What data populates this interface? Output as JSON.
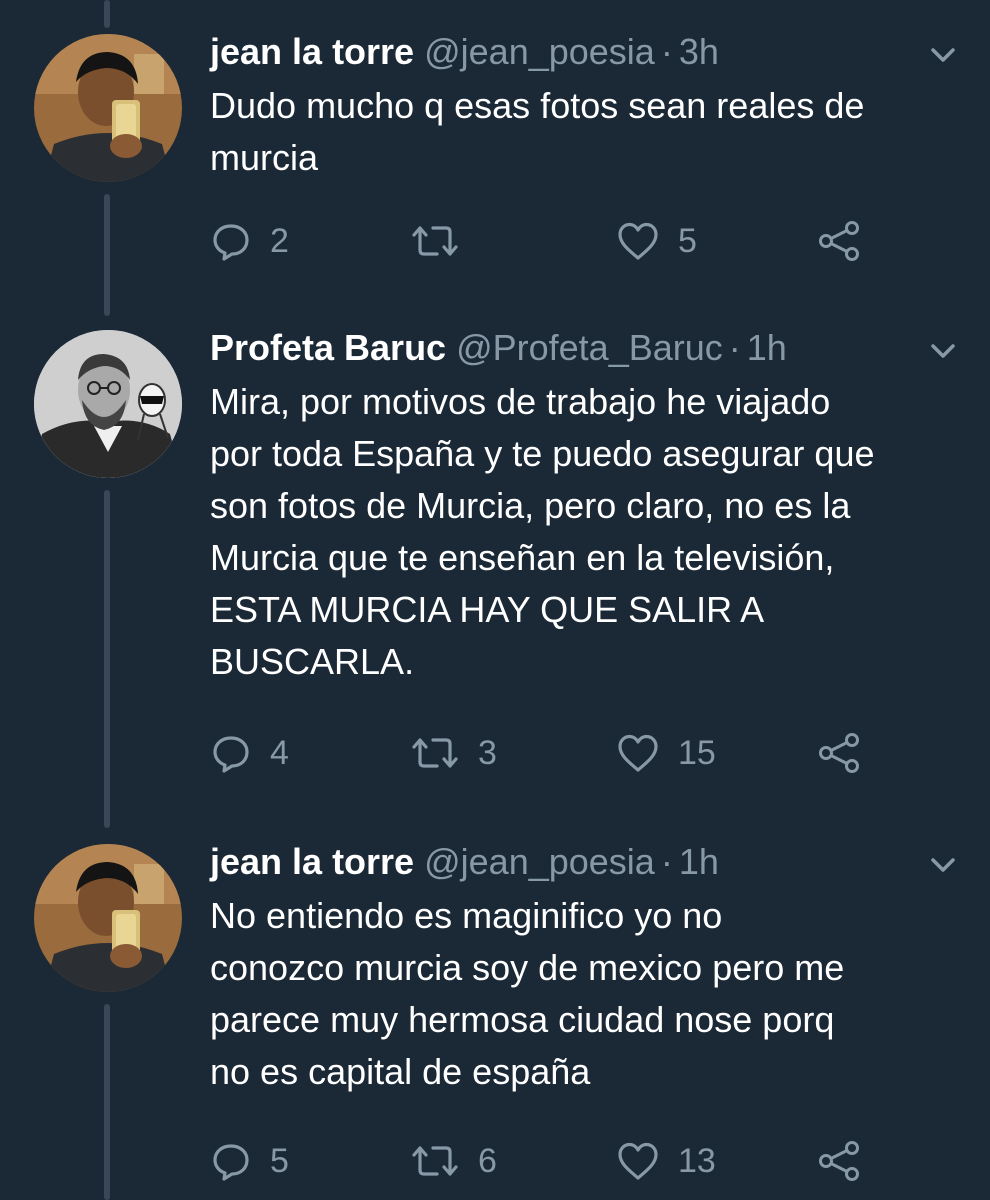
{
  "colors": {
    "background": "#1b2836",
    "text": "#ffffff",
    "muted": "#8899a6",
    "thread_line": "#3a4756"
  },
  "tweets": [
    {
      "name": "jean la torre",
      "handle": "@jean_poesia",
      "separator": "·",
      "time": "3h",
      "text_lines": [
        "Dudo mucho q esas fotos sean reales de",
        "murcia"
      ],
      "avatar": "selfie-avatar",
      "replies": "2",
      "retweets": "",
      "likes": "5"
    },
    {
      "name": "Profeta Baruc",
      "handle": "@Profeta_Baruc",
      "separator": "·",
      "time": "1h",
      "text_lines": [
        "Mira, por motivos de trabajo he viajado",
        "por toda España y te puedo asegurar que",
        "son fotos de Murcia, pero claro, no es la",
        "Murcia que te enseñan en la televisión,",
        "ESTA MURCIA HAY QUE SALIR A",
        "BUSCARLA."
      ],
      "avatar": "vintage-portrait-avatar",
      "replies": "4",
      "retweets": "3",
      "likes": "15"
    },
    {
      "name": "jean la torre",
      "handle": "@jean_poesia",
      "separator": "·",
      "time": "1h",
      "text_lines": [
        "No entiendo es maginifico yo no",
        "conozco murcia soy de mexico pero me",
        "parece muy hermosa ciudad nose porq",
        "no es capital de españa"
      ],
      "avatar": "selfie-avatar",
      "replies": "5",
      "retweets": "6",
      "likes": "13"
    }
  ]
}
